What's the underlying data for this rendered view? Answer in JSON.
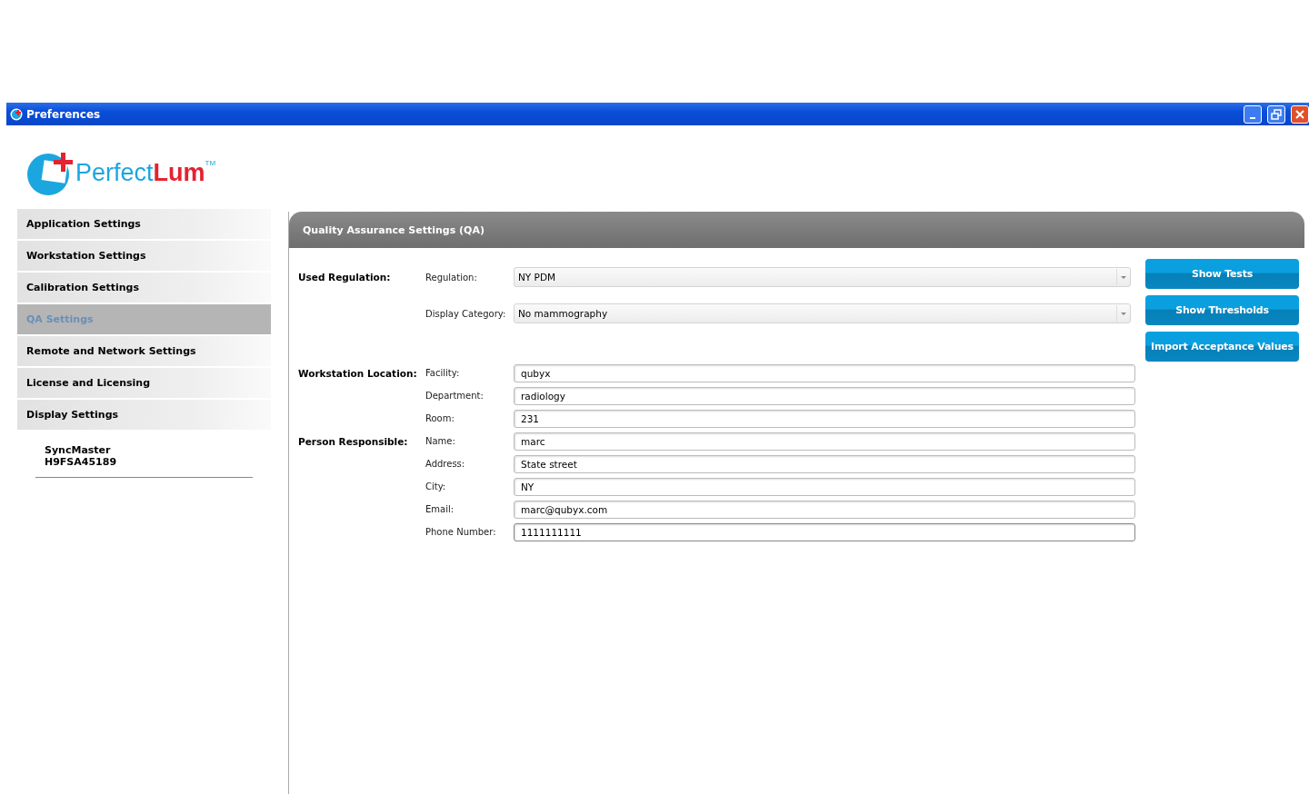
{
  "window": {
    "title": "Preferences"
  },
  "logo": {
    "text_main": "Perfect",
    "text_accent": "Lum",
    "trademark": "TM"
  },
  "sidebar": {
    "items": [
      {
        "label": "Application Settings",
        "selected": false
      },
      {
        "label": "Workstation Settings",
        "selected": false
      },
      {
        "label": "Calibration Settings",
        "selected": false
      },
      {
        "label": "QA Settings",
        "selected": true
      },
      {
        "label": "Remote and Network Settings",
        "selected": false
      },
      {
        "label": "License and Licensing",
        "selected": false
      },
      {
        "label": "Display Settings",
        "selected": false,
        "children": [
          {
            "lines": [
              "SyncMaster",
              "H9FSA45189"
            ]
          }
        ]
      }
    ]
  },
  "panel": {
    "title": "Quality Assurance Settings (QA)",
    "sections": [
      {
        "title": "Used Regulation:",
        "rows": [
          {
            "label": "Regulation:",
            "kind": "dropdown",
            "value": "NY PDM"
          },
          {
            "label": "Display Category:",
            "kind": "dropdown",
            "value": "No mammography"
          }
        ]
      },
      {
        "title": "Workstation Location:",
        "rows": [
          {
            "label": "Facility:",
            "kind": "text",
            "value": "qubyx",
            "focused": false
          },
          {
            "label": "Department:",
            "kind": "text",
            "value": "radiology",
            "focused": false
          },
          {
            "label": "Room:",
            "kind": "text",
            "value": "231",
            "focused": false
          }
        ]
      },
      {
        "title": "Person Responsible:",
        "rows": [
          {
            "label": "Name:",
            "kind": "text",
            "value": "marc",
            "focused": false
          },
          {
            "label": "Address:",
            "kind": "text",
            "value": "State street",
            "focused": false
          },
          {
            "label": "City:",
            "kind": "text",
            "value": "NY",
            "focused": false
          },
          {
            "label": "Email:",
            "kind": "text",
            "value": "marc@qubyx.com",
            "focused": false
          },
          {
            "label": "Phone Number:",
            "kind": "text",
            "value": "1111111111",
            "focused": true
          }
        ]
      }
    ],
    "buttons": [
      "Show Tests",
      "Show Thresholds",
      "Import Acceptance Values"
    ]
  }
}
